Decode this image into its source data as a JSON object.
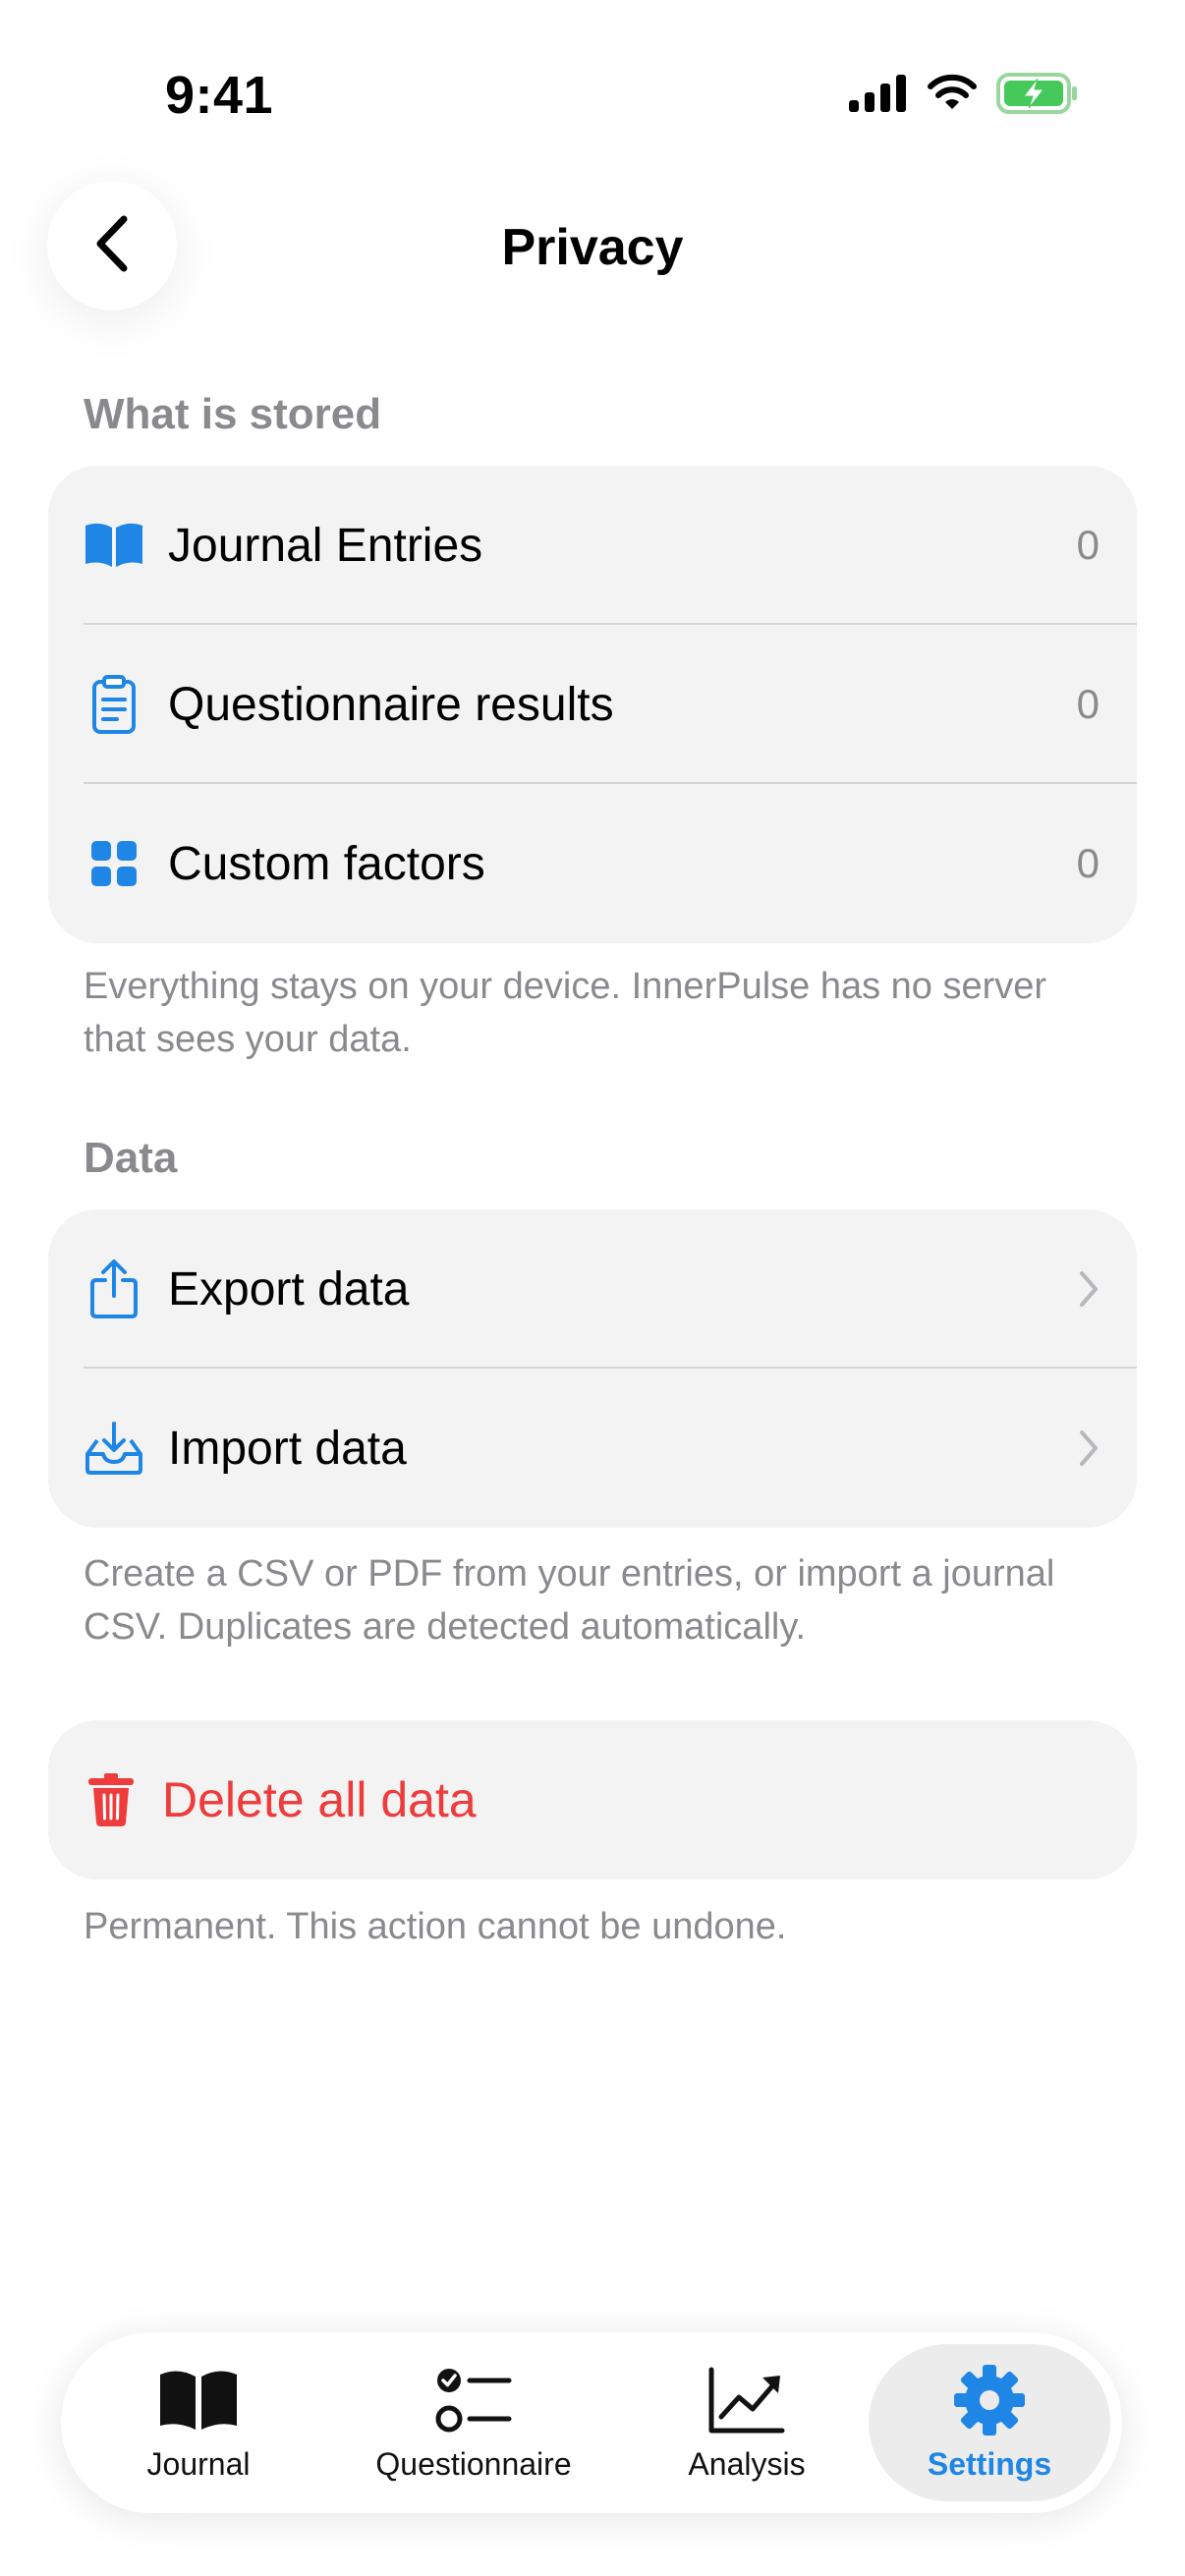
{
  "status_bar": {
    "time": "9:41"
  },
  "header": {
    "title": "Privacy",
    "back_icon": "chevron-left-icon"
  },
  "stored": {
    "section_label": "What is stored",
    "items": [
      {
        "label": "Journal Entries",
        "value": "0",
        "icon": "book-icon"
      },
      {
        "label": "Questionnaire results",
        "value": "0",
        "icon": "clipboard-icon"
      },
      {
        "label": "Custom factors",
        "value": "0",
        "icon": "grid-icon"
      }
    ],
    "footnote": "Everything stays on your device. InnerPulse has no server that sees your data."
  },
  "data_section": {
    "section_label": "Data",
    "items": [
      {
        "label": "Export data",
        "icon": "share-icon"
      },
      {
        "label": "Import data",
        "icon": "tray-download-icon"
      }
    ],
    "footnote": "Create a CSV or PDF from your entries, or import a journal CSV. Duplicates are detected automatically."
  },
  "danger": {
    "delete_label": "Delete all data",
    "footnote": "Permanent. This action cannot be undone."
  },
  "tab_bar": {
    "tabs": [
      {
        "label": "Journal",
        "icon": "book-icon"
      },
      {
        "label": "Questionnaire",
        "icon": "checklist-icon"
      },
      {
        "label": "Analysis",
        "icon": "chart-up-icon"
      },
      {
        "label": "Settings",
        "icon": "gear-icon",
        "active": true
      }
    ]
  },
  "colors": {
    "accent": "#1f86e6",
    "destructive": "#ee3b3b",
    "card_background": "#f3f3f3",
    "secondary_text": "#8a8a8e"
  }
}
